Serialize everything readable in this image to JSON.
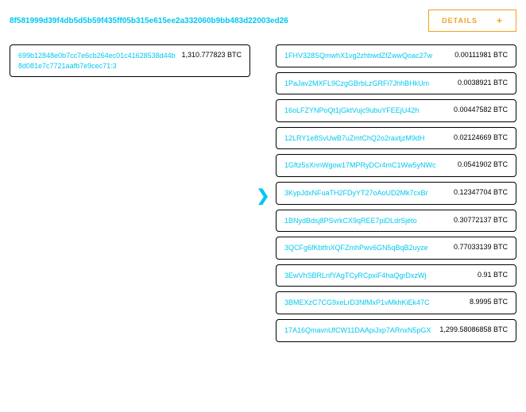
{
  "header": {
    "tx_hash": "8f581999d39f4db5d5b59f435ff05b315e615ee2a332060b9bb483d22003ed26",
    "details_label": "DETAILS",
    "details_plus": "+"
  },
  "inputs": [
    {
      "address": "699b12848e0b7cc7e6cb264ec01c41628538d44b8d081e7c7721aafb7e9cec71:3",
      "amount": "1,310.777823 BTC"
    }
  ],
  "arrow": "❯",
  "outputs": [
    {
      "address": "1FHV328SQmwhX1vg2zhbwdZfZwwQoac27w",
      "amount": "0.00111981 BTC"
    },
    {
      "address": "1PaJav2MXFL9CzgGBrbLzGRFi7JhhBHkUm",
      "amount": "0.0038921 BTC"
    },
    {
      "address": "16oLFZYNPoQt1jGktVujc9ubuYFEEjU42h",
      "amount": "0.00447582 BTC"
    },
    {
      "address": "12LRY1e8SvUwB7uZmtChQ2o2raxtjzM9dH",
      "amount": "0.02124669 BTC"
    },
    {
      "address": "1Gftz5sXnnWgow17MPRyDCr4mC1Ww5yNWc",
      "amount": "0.0541902 BTC"
    },
    {
      "address": "3KypJdxNFuaTH2FDyYT27oAoUD2Mk7cxBr",
      "amount": "0.12347704 BTC"
    },
    {
      "address": "1BNydBdsj8PSvrkCX9qREE7piDLdrSjéto",
      "amount": "0.30772137 BTC"
    },
    {
      "address": "3QCFg6fKbtfnXQFZmhPwv6GN5qBqB2uyze",
      "amount": "0.77033139 BTC"
    },
    {
      "address": "3EwVhSBRLnfYAgTCyRCpxiF4haQgrDxzWj",
      "amount": "0.91 BTC"
    },
    {
      "address": "3BMEXzC7CG9xeLrD3NfMxP1vMkhKiEk47C",
      "amount": "8.9995 BTC"
    },
    {
      "address": "17A16QmavnUfCW11DAApiJxp7ARnxN5pGX",
      "amount": "1,299.58086858 BTC"
    }
  ]
}
